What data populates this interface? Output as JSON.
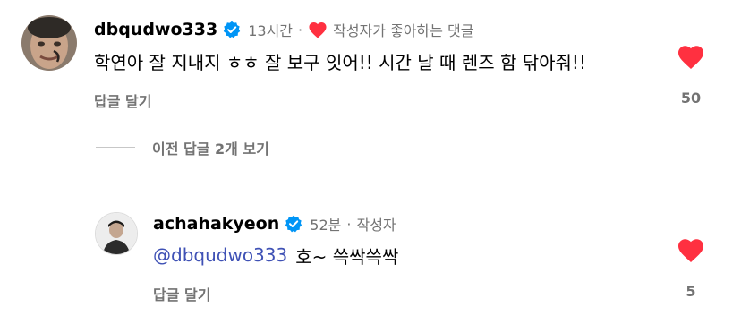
{
  "comment": {
    "username": "dbqudwo333",
    "time": "13시간",
    "liked_by_author": "작성자가 좋아하는 댓글",
    "text": "학연아 잘 지내지 ㅎㅎ 잘 보구 잇어!! 시간 날 때 렌즈 함 닦아줘!!",
    "reply_label": "답글 달기",
    "like_count": "50"
  },
  "view_previous": "이전 답글 2개 보기",
  "reply": {
    "username": "achahakyeon",
    "time": "52분",
    "author_badge": "작성자",
    "mention": "@dbqudwo333",
    "text": "호~ 쓱싹쓱싹",
    "reply_label": "답글 달기",
    "like_count": "5"
  },
  "colors": {
    "heart": "#ff3040",
    "verified": "#0095f6",
    "mention": "#3f51b5",
    "secondary_text": "#737373"
  },
  "icons": [
    "verified-badge-icon",
    "heart-filled-icon"
  ]
}
